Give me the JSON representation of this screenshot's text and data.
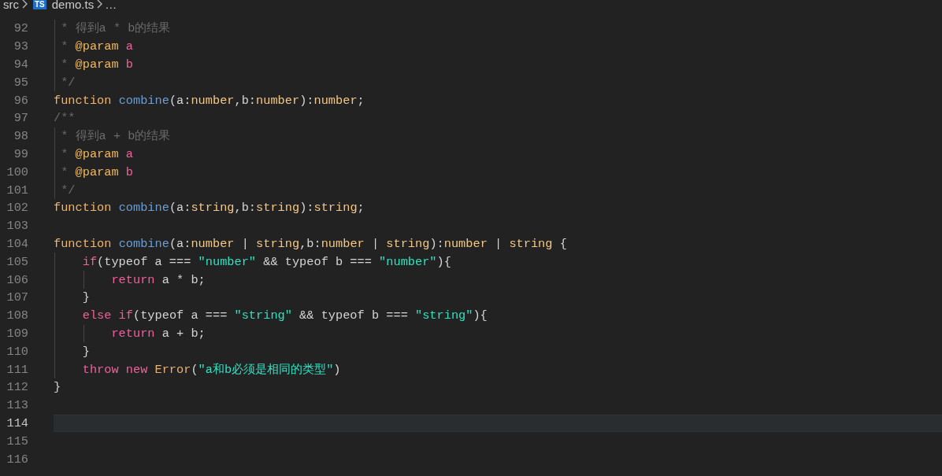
{
  "breadcrumb": {
    "folder": "src",
    "file_badge": "TS",
    "file": "demo.ts",
    "more": "…"
  },
  "lines": [
    {
      "number": "92",
      "current": false,
      "tokens": [
        {
          "kind": "comment",
          "text": " * 得到a * b的结果"
        }
      ]
    },
    {
      "number": "93",
      "current": false,
      "tokens": [
        {
          "kind": "comment",
          "text": " * "
        },
        {
          "kind": "doctag",
          "text": "@param "
        },
        {
          "kind": "docname",
          "text": "a"
        }
      ]
    },
    {
      "number": "94",
      "current": false,
      "tokens": [
        {
          "kind": "comment",
          "text": " * "
        },
        {
          "kind": "doctag",
          "text": "@param "
        },
        {
          "kind": "docname",
          "text": "b"
        }
      ]
    },
    {
      "number": "95",
      "current": false,
      "tokens": [
        {
          "kind": "comment",
          "text": " */"
        }
      ]
    },
    {
      "number": "96",
      "current": false,
      "tokens": [
        {
          "kind": "storage",
          "text": "function "
        },
        {
          "kind": "function",
          "text": "combine"
        },
        {
          "kind": "plain",
          "text": "(a:"
        },
        {
          "kind": "type",
          "text": "number"
        },
        {
          "kind": "plain",
          "text": ",b:"
        },
        {
          "kind": "type",
          "text": "number"
        },
        {
          "kind": "plain",
          "text": "):"
        },
        {
          "kind": "type",
          "text": "number"
        },
        {
          "kind": "plain",
          "text": ";"
        }
      ]
    },
    {
      "number": "97",
      "current": false,
      "tokens": [
        {
          "kind": "comment",
          "text": "/**"
        }
      ]
    },
    {
      "number": "98",
      "current": false,
      "tokens": [
        {
          "kind": "comment",
          "text": " * 得到a + b的结果"
        }
      ]
    },
    {
      "number": "99",
      "current": false,
      "tokens": [
        {
          "kind": "comment",
          "text": " * "
        },
        {
          "kind": "doctag",
          "text": "@param "
        },
        {
          "kind": "docname",
          "text": "a"
        }
      ]
    },
    {
      "number": "100",
      "current": false,
      "tokens": [
        {
          "kind": "comment",
          "text": " * "
        },
        {
          "kind": "doctag",
          "text": "@param "
        },
        {
          "kind": "docname",
          "text": "b"
        }
      ]
    },
    {
      "number": "101",
      "current": false,
      "tokens": [
        {
          "kind": "comment",
          "text": " */"
        }
      ]
    },
    {
      "number": "102",
      "current": false,
      "tokens": [
        {
          "kind": "storage",
          "text": "function "
        },
        {
          "kind": "function",
          "text": "combine"
        },
        {
          "kind": "plain",
          "text": "(a:"
        },
        {
          "kind": "type",
          "text": "string"
        },
        {
          "kind": "plain",
          "text": ",b:"
        },
        {
          "kind": "type",
          "text": "string"
        },
        {
          "kind": "plain",
          "text": "):"
        },
        {
          "kind": "type",
          "text": "string"
        },
        {
          "kind": "plain",
          "text": ";"
        }
      ]
    },
    {
      "number": "103",
      "current": false
    },
    {
      "number": "104",
      "current": false,
      "tokens": [
        {
          "kind": "storage",
          "text": "function "
        },
        {
          "kind": "function",
          "text": "combine"
        },
        {
          "kind": "plain",
          "text": "(a:"
        },
        {
          "kind": "type",
          "text": "number"
        },
        {
          "kind": "plain",
          "text": " | "
        },
        {
          "kind": "type",
          "text": "string"
        },
        {
          "kind": "plain",
          "text": ",b:"
        },
        {
          "kind": "type",
          "text": "number"
        },
        {
          "kind": "plain",
          "text": " | "
        },
        {
          "kind": "type",
          "text": "string"
        },
        {
          "kind": "plain",
          "text": "):"
        },
        {
          "kind": "type",
          "text": "number"
        },
        {
          "kind": "plain",
          "text": " | "
        },
        {
          "kind": "type",
          "text": "string"
        },
        {
          "kind": "plain",
          "text": " {"
        }
      ]
    },
    {
      "number": "105",
      "current": false,
      "tokens": [
        {
          "kind": "keyword",
          "text": "    if"
        },
        {
          "kind": "plain",
          "text": "(typeof a === "
        },
        {
          "kind": "string",
          "text": "\"number\""
        },
        {
          "kind": "plain",
          "text": " && typeof b === "
        },
        {
          "kind": "string",
          "text": "\"number\""
        },
        {
          "kind": "plain",
          "text": "){"
        }
      ]
    },
    {
      "number": "106",
      "current": false,
      "tokens": [
        {
          "kind": "keyword",
          "text": "        return"
        },
        {
          "kind": "plain",
          "text": " a * b;"
        }
      ]
    },
    {
      "number": "107",
      "current": false,
      "tokens": [
        {
          "kind": "plain",
          "text": "    }"
        }
      ]
    },
    {
      "number": "108",
      "current": false,
      "tokens": [
        {
          "kind": "keyword",
          "text": "    else if"
        },
        {
          "kind": "plain",
          "text": "(typeof a === "
        },
        {
          "kind": "string",
          "text": "\"string\""
        },
        {
          "kind": "plain",
          "text": " && typeof b === "
        },
        {
          "kind": "string",
          "text": "\"string\""
        },
        {
          "kind": "plain",
          "text": "){"
        }
      ]
    },
    {
      "number": "109",
      "current": false,
      "tokens": [
        {
          "kind": "keyword",
          "text": "        return"
        },
        {
          "kind": "plain",
          "text": " a + b;"
        }
      ]
    },
    {
      "number": "110",
      "current": false,
      "tokens": [
        {
          "kind": "plain",
          "text": "    }"
        }
      ]
    },
    {
      "number": "111",
      "current": false,
      "tokens": [
        {
          "kind": "keyword",
          "text": "    throw new "
        },
        {
          "kind": "class",
          "text": "Error"
        },
        {
          "kind": "plain",
          "text": "("
        },
        {
          "kind": "string",
          "text": "\"a和b必须是相同的类型\""
        },
        {
          "kind": "plain",
          "text": ")"
        }
      ]
    },
    {
      "number": "112",
      "current": false,
      "tokens": [
        {
          "kind": "plain",
          "text": "}"
        }
      ]
    },
    {
      "number": "113",
      "current": false
    },
    {
      "number": "114",
      "current": true
    },
    {
      "number": "115",
      "current": false
    },
    {
      "number": "116",
      "current": false
    }
  ]
}
